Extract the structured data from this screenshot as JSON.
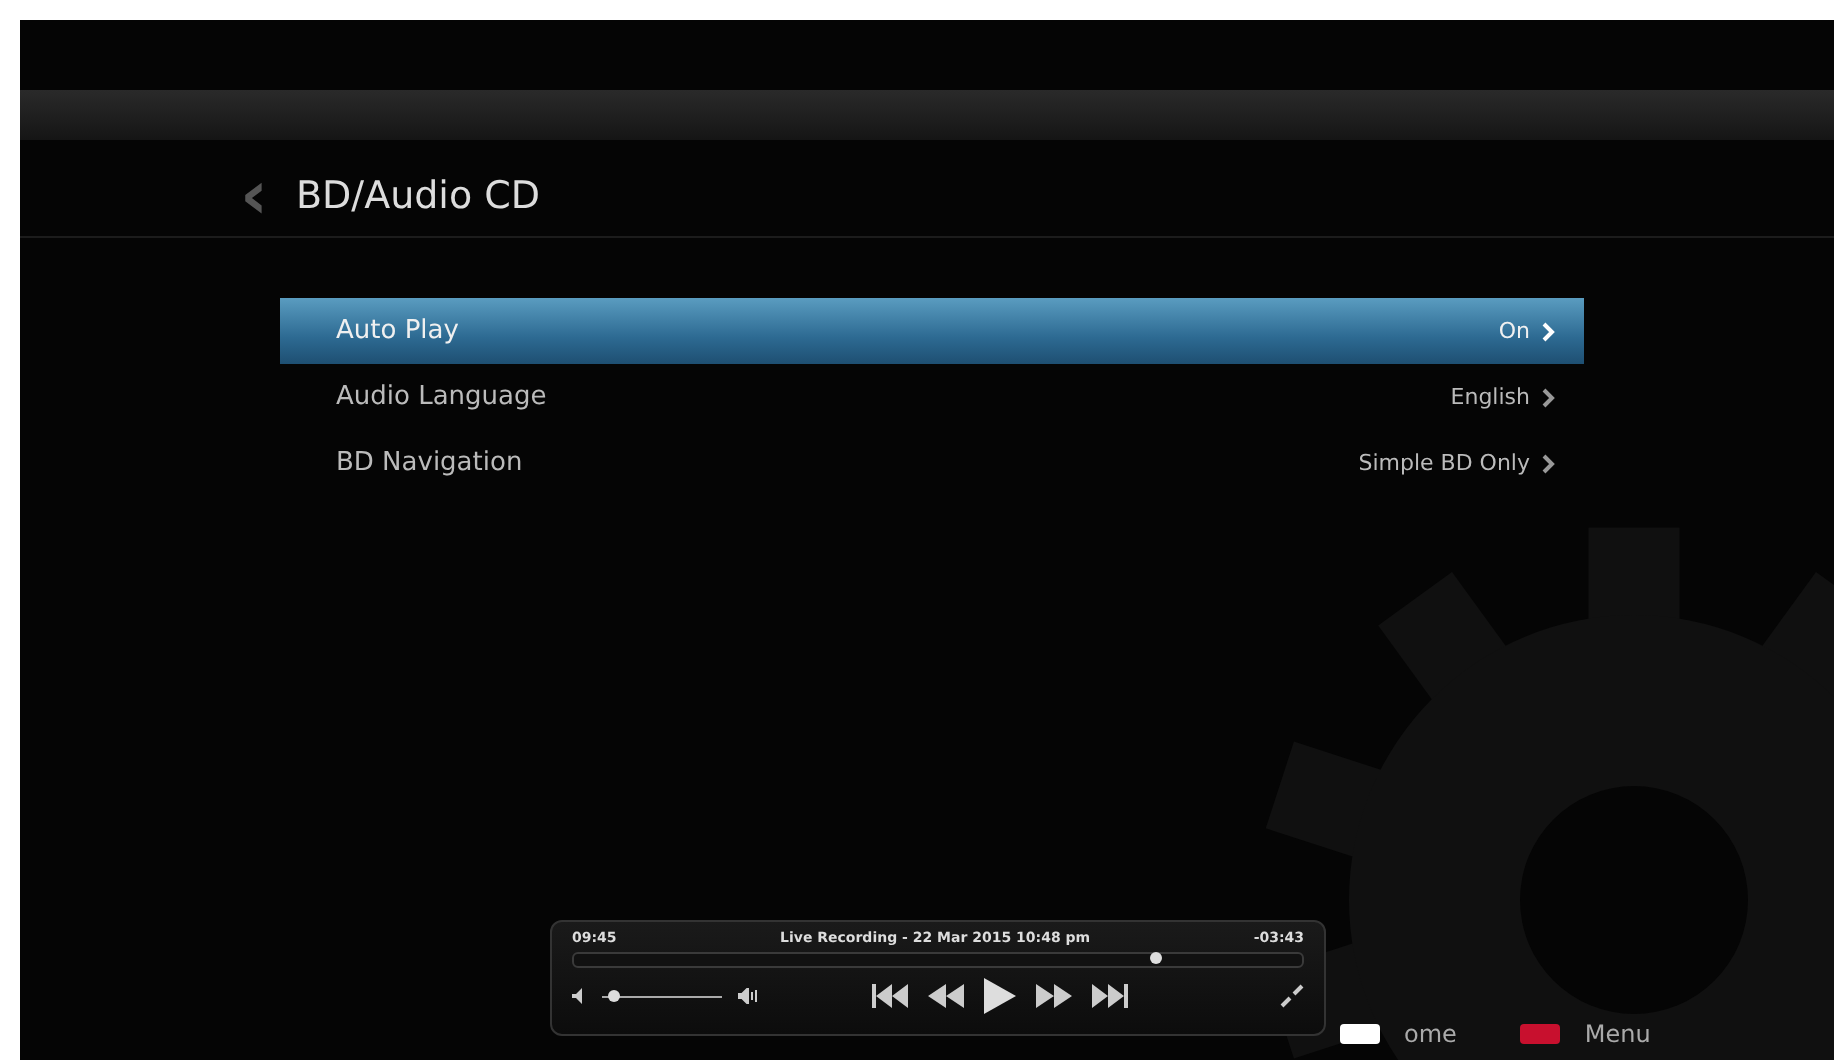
{
  "header": {
    "back_symbol": "‹",
    "title": "BD/Audio CD"
  },
  "settings": [
    {
      "label": "Auto Play",
      "value": "On",
      "selected": true
    },
    {
      "label": "Audio Language",
      "value": "English",
      "selected": false
    },
    {
      "label": "BD Navigation",
      "value": "Simple BD Only",
      "selected": false
    }
  ],
  "player": {
    "elapsed": "09:45",
    "title": "Live Recording - 22 Mar 2015 10:48 pm",
    "remaining": "-03:43",
    "progress": {
      "level": 0.8
    },
    "volume": {
      "level": 0.1
    }
  },
  "footer": [
    {
      "label": "ome",
      "color": "#ffffff"
    },
    {
      "label": "Menu",
      "color": "#c8102e"
    }
  ]
}
